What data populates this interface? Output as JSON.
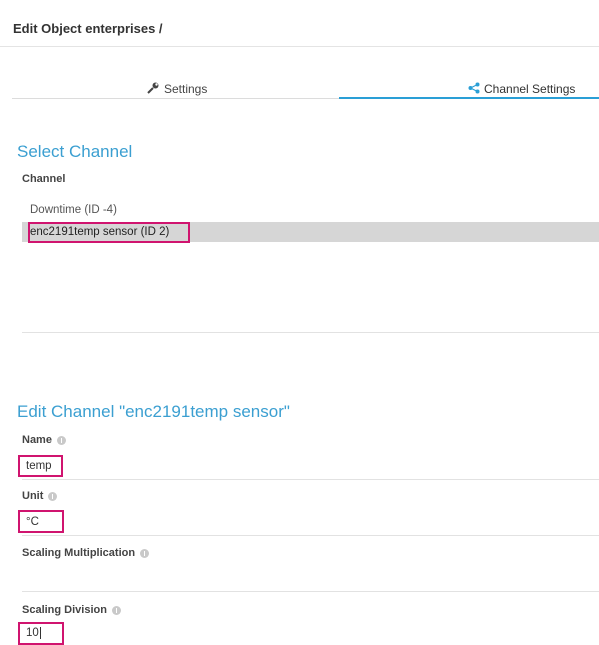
{
  "header": {
    "title": "Edit Object enterprises /"
  },
  "tabs": [
    {
      "label": "Settings",
      "icon": "wrench-icon"
    },
    {
      "label": "Channel Settings",
      "icon": "share-icon",
      "active": true
    }
  ],
  "select_channel": {
    "title": "Select Channel",
    "label": "Channel",
    "options": [
      {
        "label": "Downtime (ID -4)"
      },
      {
        "label": "enc2191temp sensor (ID 2)",
        "selected": true
      }
    ]
  },
  "edit_channel": {
    "title": "Edit Channel \"enc2191temp sensor\"",
    "name": {
      "label": "Name",
      "value": "temp"
    },
    "unit": {
      "label": "Unit",
      "value": "°C"
    },
    "scaling_multiplication": {
      "label": "Scaling Multiplication",
      "value": ""
    },
    "scaling_division": {
      "label": "Scaling Division",
      "value": "10"
    }
  },
  "colors": {
    "accent": "#3b9fd1",
    "highlight": "#d0146f",
    "selected_bg": "#d6d6d6"
  }
}
